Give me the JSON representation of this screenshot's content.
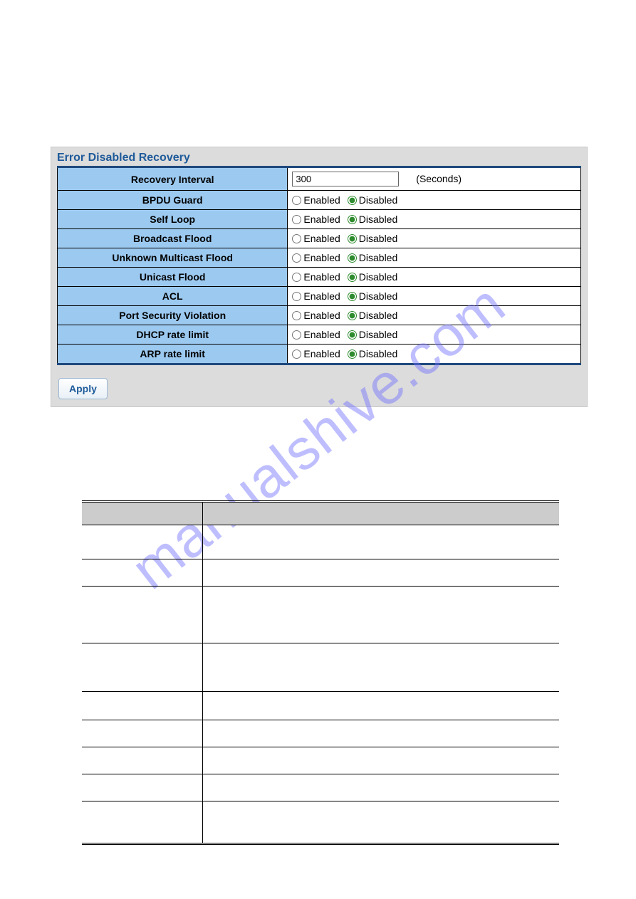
{
  "panel": {
    "title": "Error Disabled Recovery",
    "recovery_interval_label": "Recovery Interval",
    "recovery_interval_value": "300",
    "seconds_label": "(Seconds)",
    "enabled_label": "Enabled",
    "disabled_label": "Disabled",
    "apply_label": "Apply",
    "rows": [
      {
        "label": "BPDU Guard",
        "selected": "disabled"
      },
      {
        "label": "Self Loop",
        "selected": "disabled"
      },
      {
        "label": "Broadcast Flood",
        "selected": "disabled"
      },
      {
        "label": "Unknown Multicast Flood",
        "selected": "disabled"
      },
      {
        "label": "Unicast Flood",
        "selected": "disabled"
      },
      {
        "label": "ACL",
        "selected": "disabled"
      },
      {
        "label": "Port Security Violation",
        "selected": "disabled"
      },
      {
        "label": "DHCP rate limit",
        "selected": "disabled"
      },
      {
        "label": "ARP rate limit",
        "selected": "disabled"
      }
    ]
  },
  "watermark": "manualshive.com"
}
